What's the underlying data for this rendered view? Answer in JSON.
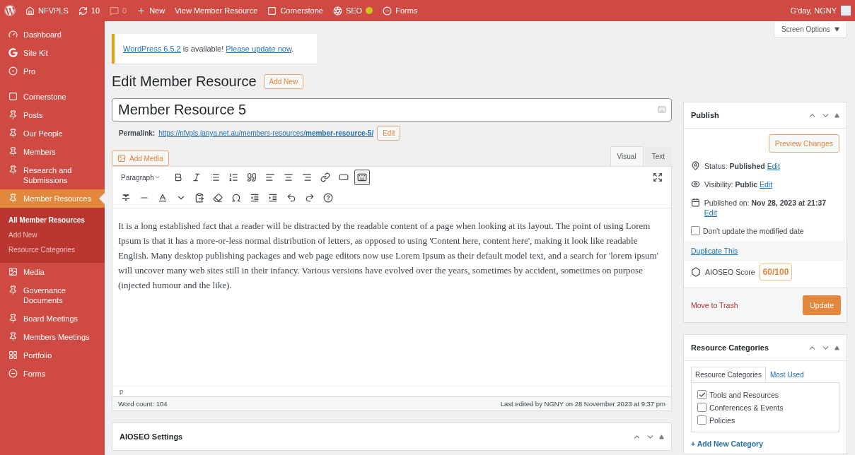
{
  "admin_bar": {
    "items": [
      {
        "label": "NFVPLS",
        "muted": false
      },
      {
        "label": "10",
        "muted": false
      },
      {
        "label": "0",
        "muted": true
      },
      {
        "label": "New",
        "muted": false
      },
      {
        "label": "View Member Resource",
        "muted": false
      },
      {
        "label": "Cornerstone",
        "muted": false
      },
      {
        "label": "SEO",
        "muted": false
      },
      {
        "label": "Forms",
        "muted": false
      }
    ],
    "greeting": "G'day, NGNY"
  },
  "sidebar": {
    "sections": [
      {
        "items": [
          {
            "label": "Dashboard",
            "selected": false
          },
          {
            "label": "Site Kit",
            "selected": false
          },
          {
            "label": "Pro",
            "selected": false
          }
        ]
      },
      {
        "items": [
          {
            "label": "Cornerstone",
            "selected": false
          },
          {
            "label": "Posts",
            "selected": false
          },
          {
            "label": "Our People",
            "selected": false
          },
          {
            "label": "Members",
            "selected": false
          },
          {
            "label": "Research and Submissions",
            "selected": false
          },
          {
            "label": "Member Resources",
            "selected": true,
            "children": [
              {
                "label": "All Member Resources",
                "selected": true
              },
              {
                "label": "Add New",
                "selected": false
              },
              {
                "label": "Resource Categories",
                "selected": false
              }
            ]
          },
          {
            "label": "Media",
            "selected": false
          },
          {
            "label": "Governance Documents",
            "selected": false
          },
          {
            "label": "Board Meetings",
            "selected": false
          },
          {
            "label": "Members Meetings",
            "selected": false
          },
          {
            "label": "Portfolio",
            "selected": false
          },
          {
            "label": "Forms",
            "selected": false
          }
        ]
      }
    ]
  },
  "screen_options": "Screen Options",
  "notice": {
    "parts": [
      {
        "text": "WordPress 6.5.2",
        "link": true
      },
      {
        "text": " is available! ",
        "link": false
      },
      {
        "text": "Please update now",
        "link": true
      },
      {
        "text": ".",
        "link": false
      }
    ]
  },
  "page": {
    "heading": "Edit Member Resource",
    "add_new": "Add New"
  },
  "editor": {
    "title": "Member Resource 5",
    "permalink": {
      "label": "Permalink:",
      "url": "https://nfvpls.janya.net.au/members-resources/**member-resource-5/**",
      "button": "Edit"
    },
    "add_media": "Add Media",
    "tabs": [
      {
        "label": "Visual",
        "selected": true
      },
      {
        "label": "Text",
        "selected": false
      }
    ],
    "format_select": "Paragraph",
    "toolbar_toggle_pressed": true,
    "content": "It is a long established fact that a reader will be distracted by the readable content of a page when looking at its layout. The point of using Lorem Ipsum is that it has a more-or-less normal distribution of letters, as opposed to using 'Content here, content here', making it look like readable English. Many desktop publishing packages and web page editors now use Lorem Ipsum as their default model text, and a search for 'lorem ipsum' will uncover many web sites still in their infancy. Various versions have evolved over the years, sometimes by accident, sometimes on purpose (injected humour and the like).",
    "path": "p",
    "word_count": "Word count: 104",
    "last_edited": "Last edited by NGNY on 28 November 2023 at 9:37 pm"
  },
  "aioseo_box": {
    "title": "AIOSEO Settings"
  },
  "publish": {
    "title": "Publish",
    "preview_button": "Preview Changes",
    "rows": [
      {
        "text": "Status: **Published**",
        "link": "Edit"
      },
      {
        "text": "Visibility: **Public**",
        "link": "Edit"
      },
      {
        "text": "Published on: **Nov 28, 2023 at 21:37**",
        "link": "Edit"
      }
    ],
    "dont_update": {
      "label": "Don't update the modified date",
      "checked": false
    },
    "duplicate": "Duplicate This",
    "seo_score": {
      "label": "AIOSEO Score",
      "value": "60/100"
    },
    "trash": "Move to Trash",
    "update": "Update"
  },
  "categories": {
    "title": "Resource Categories",
    "tabs": [
      {
        "label": "Resource Categories",
        "selected": true
      },
      {
        "label": "Most Used",
        "selected": false
      }
    ],
    "items": [
      {
        "label": "Tools and Resources",
        "checked": true
      },
      {
        "label": "Conferences & Events",
        "checked": false
      },
      {
        "label": "Policies",
        "checked": false
      }
    ],
    "add_link": "+ Add New Category"
  }
}
